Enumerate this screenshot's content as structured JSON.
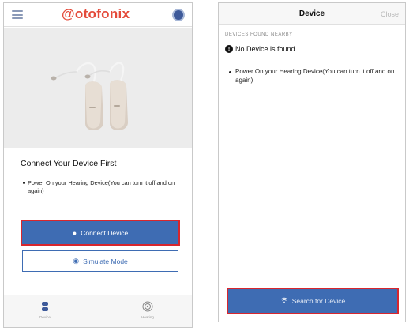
{
  "left_screen": {
    "logo_text": "otofonix",
    "logo_prefix": "@",
    "title": "Connect Your Device First",
    "bullet": "Power On your Hearing Device(You can turn it off and on again)",
    "connect_button": "Connect Device",
    "simulate_button": "Simulate Mode",
    "tabs": [
      {
        "label": "Device",
        "icon": "device-icon"
      },
      {
        "label": "Hearing",
        "icon": "hearing-icon"
      }
    ]
  },
  "right_screen": {
    "title": "Device",
    "close_label": "Close",
    "section_header": "DEVICES FOUND NEARBY",
    "no_device_text": "No Device is found",
    "bullet": "Power On your Hearing Device(You can turn it off and on again)",
    "search_button": "Search for Device"
  },
  "colors": {
    "brand": "#e44a3a",
    "primary": "#3e6cb3",
    "highlight_border": "#d8262d"
  }
}
